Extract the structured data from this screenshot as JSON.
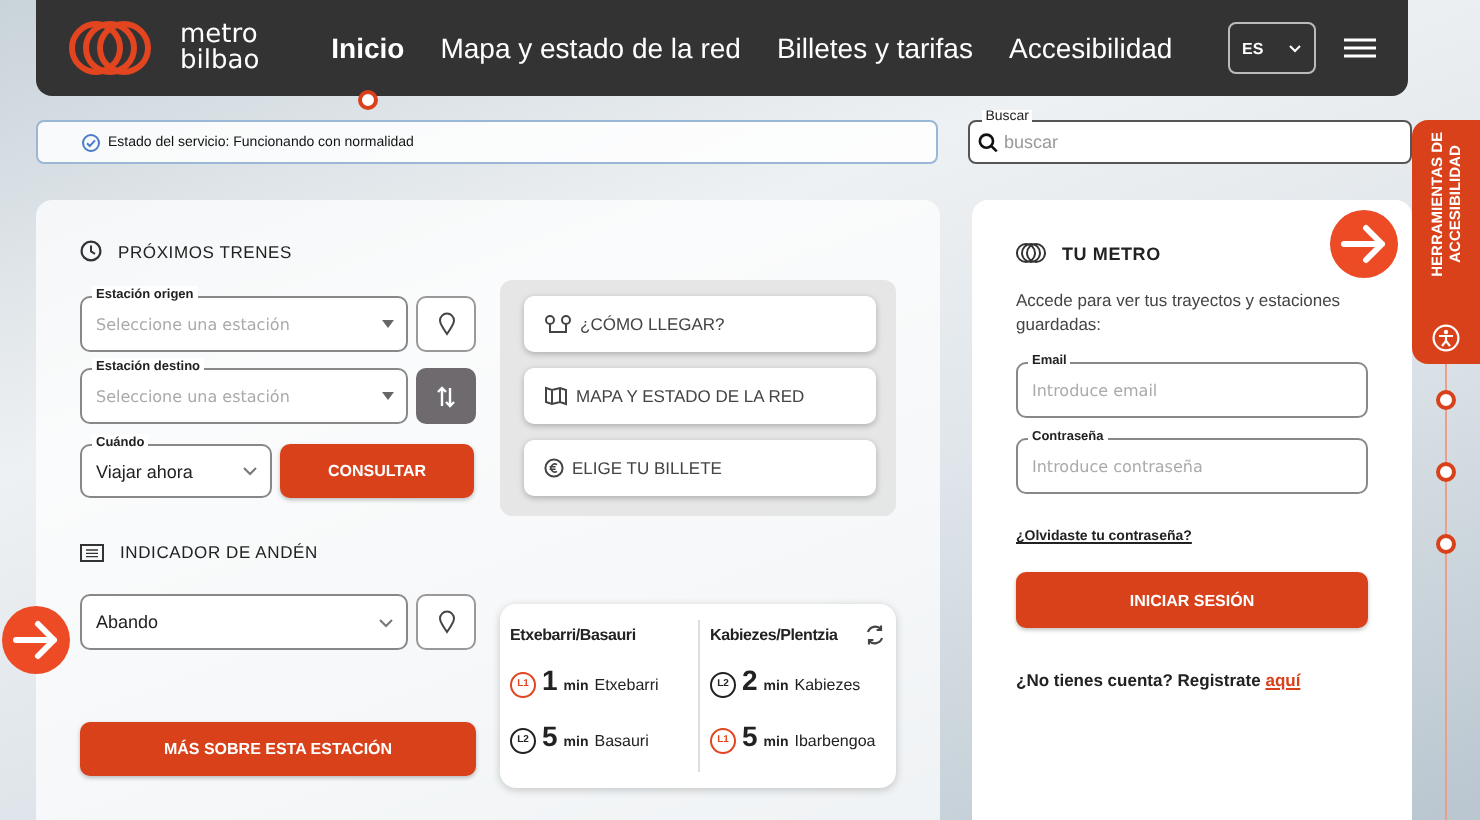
{
  "header": {
    "logo": {
      "line_1": "metro",
      "line_2": "bilbao"
    },
    "nav": [
      {
        "label": "Inicio",
        "selected": true
      },
      {
        "label": "Mapa y estado de la red",
        "selected": false
      },
      {
        "label": "Billetes y tarifas",
        "selected": false
      },
      {
        "label": "Accesibilidad",
        "selected": false
      }
    ],
    "language": "ES"
  },
  "status": {
    "text": "Estado del servicio: Funcionando con normalidad"
  },
  "search": {
    "label": "Buscar",
    "placeholder": "buscar"
  },
  "next_trains": {
    "title": "PRÓXIMOS TRENES",
    "origin": {
      "label": "Estación origen",
      "placeholder": "Seleccione una estación"
    },
    "destination": {
      "label": "Estación destino",
      "placeholder": "Seleccione una estación"
    },
    "when": {
      "label": "Cuándo",
      "value": "Viajar ahora"
    },
    "submit": "CONSULTAR"
  },
  "quick_links": [
    {
      "kind": "route",
      "label": "¿CÓMO LLEGAR?"
    },
    {
      "kind": "map",
      "label": "MAPA Y ESTADO DE LA RED"
    },
    {
      "kind": "ticket",
      "label": "ELIGE TU BILLETE"
    }
  ],
  "platform": {
    "title": "INDICADOR DE ANDÉN",
    "station": "Abando",
    "button": "MÁS SOBRE ESTA ESTACIÓN",
    "directions": [
      {
        "name": "Etxebarri/Basauri",
        "trains": [
          {
            "line": "L1",
            "color": "#e2451f",
            "minutes": "1",
            "unit": "min",
            "destination": "Etxebarri"
          },
          {
            "line": "L2",
            "color": "#222222",
            "minutes": "5",
            "unit": "min",
            "destination": "Basauri"
          }
        ]
      },
      {
        "name": "Kabiezes/Plentzia",
        "trains": [
          {
            "line": "L2",
            "color": "#222222",
            "minutes": "2",
            "unit": "min",
            "destination": "Kabiezes"
          },
          {
            "line": "L1",
            "color": "#e2451f",
            "minutes": "5",
            "unit": "min",
            "destination": "Ibarbengoa"
          }
        ]
      }
    ]
  },
  "tu_metro": {
    "title": "TU METRO",
    "intro": "Accede para ver tus trayectos y estaciones guardadas:",
    "email": {
      "label": "Email",
      "placeholder": "Introduce email"
    },
    "password": {
      "label": "Contraseña",
      "placeholder": "Introduce contraseña"
    },
    "forgot": "¿Olvidaste tu contraseña?",
    "submit": "INICIAR SESIÓN",
    "register_text": "¿No tienes cuenta? Registrate",
    "register_link": "aquí"
  },
  "accessibility_tab": {
    "line_1": "HERRAMIENTAS DE",
    "line_2": "ACCESIBILIDAD"
  }
}
